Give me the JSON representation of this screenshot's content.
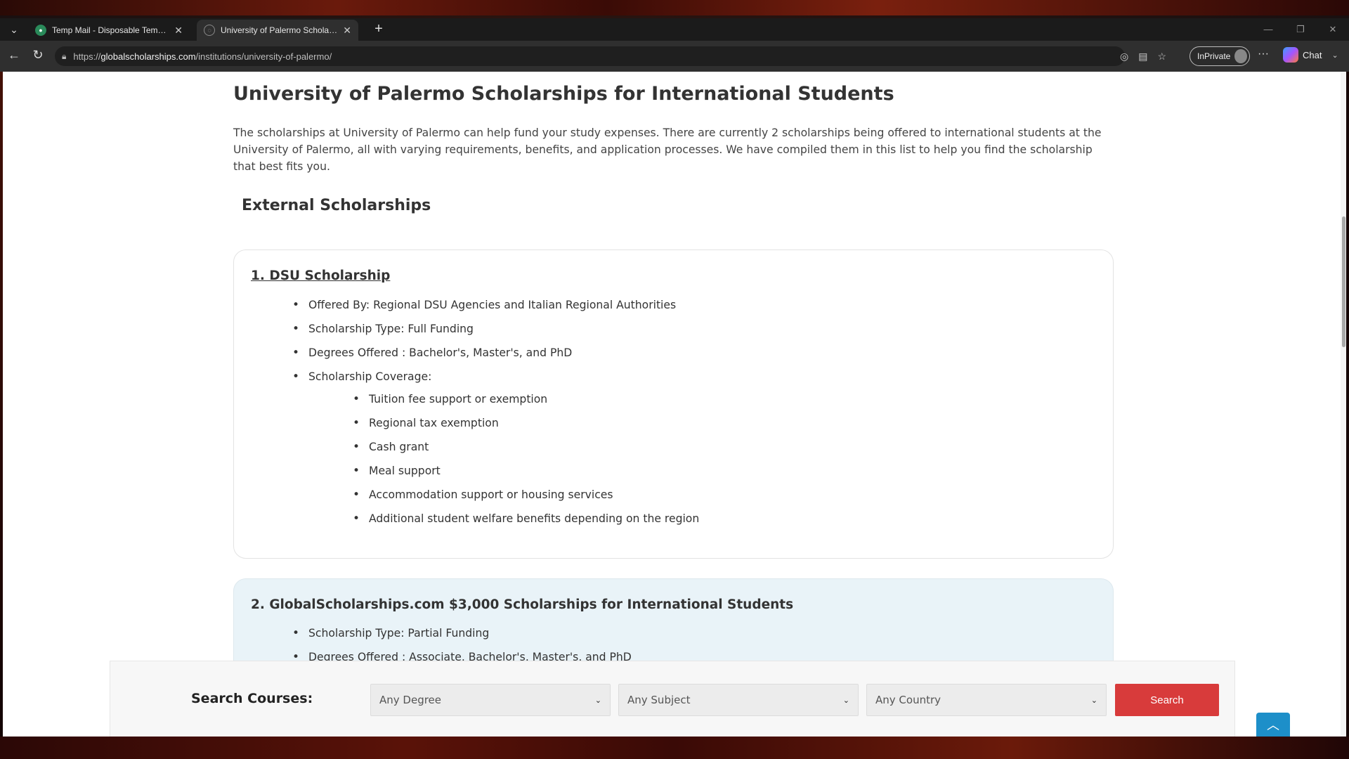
{
  "browser": {
    "tabs": [
      {
        "title": "Temp Mail - Disposable Temporary E",
        "active": false,
        "favicon": "tempmail-icon"
      },
      {
        "title": "University of Palermo Scholarships",
        "active": true,
        "favicon": "globe-icon"
      }
    ],
    "url_scheme": "https://",
    "url_host": "globalscholarships.com",
    "url_path": "/institutions/university-of-palermo/",
    "inprivate_label": "InPrivate",
    "chat_label": "Chat"
  },
  "page": {
    "title": "University of Palermo Scholarships for International Students",
    "intro": "The scholarships at University of Palermo can help fund your study expenses. There are currently 2 scholarships being offered to international students at the University of Palermo, all with varying requirements, benefits, and application processes. We have compiled them in this list to help you find the scholarship that best fits you.",
    "section_heading": "External Scholarships",
    "scholarships": [
      {
        "title": "1. DSU Scholarship",
        "items": [
          "Offered By: Regional DSU Agencies and Italian Regional Authorities",
          "Scholarship Type: Full Funding",
          "Degrees Offered : Bachelor's, Master's, and PhD",
          "Scholarship Coverage:"
        ],
        "coverage": [
          "Tuition fee support or exemption",
          "Regional tax exemption",
          "Cash grant",
          "Meal support",
          "Accommodation support or housing services",
          "Additional student welfare benefits depending on the region"
        ]
      },
      {
        "title": "2. GlobalScholarships.com $3,000 Scholarships for International Students",
        "items": [
          "Scholarship Type: Partial Funding",
          "Degrees Offered : Associate, Bachelor's, Master's, and PhD"
        ]
      }
    ]
  },
  "search": {
    "label": "Search Courses:",
    "degree": "Any Degree",
    "subject": "Any Subject",
    "country": "Any Country",
    "button": "Search"
  },
  "colors": {
    "search_button": "#d83b3b",
    "back_to_top": "#1d8fc9",
    "card2_bg": "#e9f3f8"
  }
}
